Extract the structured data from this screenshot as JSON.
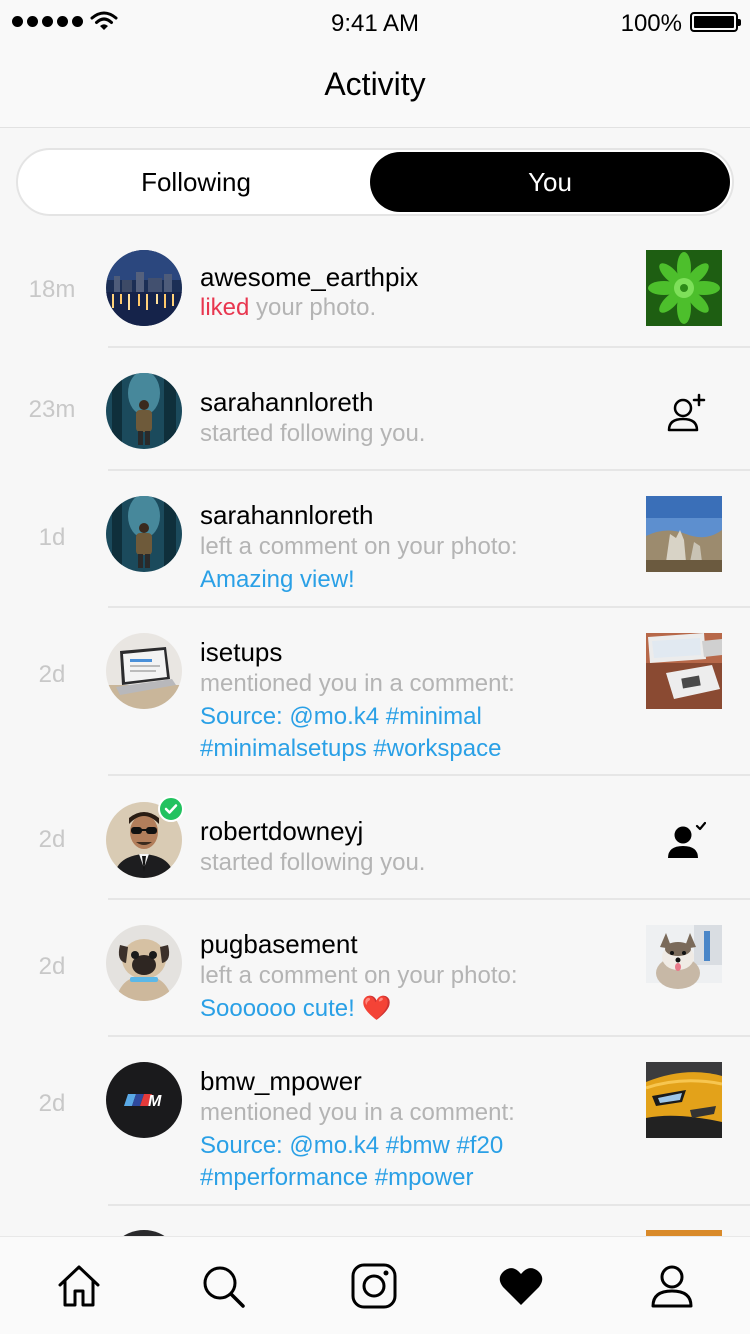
{
  "status_bar": {
    "time": "9:41 AM",
    "battery": "100%"
  },
  "header": {
    "title": "Activity"
  },
  "segments": {
    "following": "Following",
    "you": "You"
  },
  "activities": [
    {
      "time": "18m",
      "user": "awesome_earthpix",
      "highlight": "liked",
      "text": "your photo."
    },
    {
      "time": "23m",
      "user": "sarahannloreth",
      "text": "started following you."
    },
    {
      "time": "1d",
      "user": "sarahannloreth",
      "text": "left a comment on your photo:",
      "comment": "Amazing view!"
    },
    {
      "time": "2d",
      "user": "isetups",
      "text": "mentioned you in a comment:",
      "comment": "Source: @mo.k4 #minimal",
      "comment2": "#minimalsetups #workspace"
    },
    {
      "time": "2d",
      "user": "robertdowneyj",
      "text": "started following you."
    },
    {
      "time": "2d",
      "user": "pugbasement",
      "text": "left a comment on your photo:",
      "comment": "Soooooo cute! ❤️"
    },
    {
      "time": "2d",
      "user": "bmw_mpower",
      "text": "mentioned you in a comment:",
      "comment": "Source: @mo.k4 #bmw #f20",
      "comment2": "#mperformance #mpower"
    }
  ],
  "icons": {
    "follow_back": "person-plus-icon",
    "following": "person-check-icon",
    "verified": "verified-badge-icon",
    "tabs": [
      "home-icon",
      "search-icon",
      "camera-icon",
      "heart-icon",
      "profile-icon"
    ]
  },
  "colors": {
    "accent_red": "#e8364f",
    "link_blue": "#2aa0e6",
    "verified_green": "#22c25f"
  }
}
